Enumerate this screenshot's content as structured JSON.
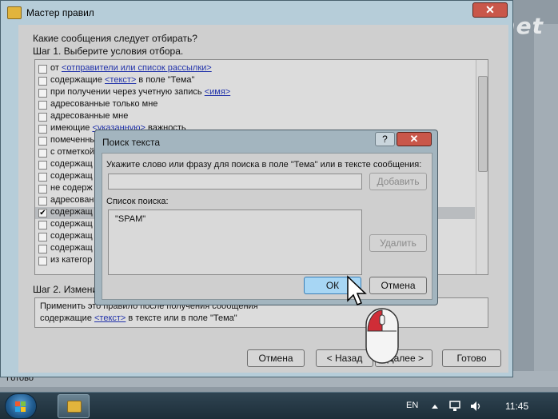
{
  "watermark": "lanet",
  "background_app": {
    "status_text": "Готово"
  },
  "rules_wizard": {
    "title": "Мастер правил",
    "close_glyph": "✕",
    "question": "Какие сообщения следует отбирать?",
    "step1": "Шаг 1. Выберите условия отбора.",
    "conditions": [
      {
        "pre": "от ",
        "link": "<отправители или список рассылки>",
        "post": "",
        "checked": false,
        "selected": false
      },
      {
        "pre": "содержащие ",
        "link": "<текст>",
        "post": " в поле \"Тема\"",
        "checked": false,
        "selected": false
      },
      {
        "pre": "при получении через учетную запись ",
        "link": "<имя>",
        "post": "",
        "checked": false,
        "selected": false
      },
      {
        "pre": "адресованные только мне",
        "link": "",
        "post": "",
        "checked": false,
        "selected": false
      },
      {
        "pre": "адресованные мне",
        "link": "",
        "post": "",
        "checked": false,
        "selected": false
      },
      {
        "pre": "имеющие ",
        "link": "<указанную>",
        "post": " важность",
        "checked": false,
        "selected": false
      },
      {
        "pre": "помеченные",
        "link": "",
        "post": "",
        "checked": false,
        "selected": false
      },
      {
        "pre": "с отметкой",
        "link": "",
        "post": "",
        "checked": false,
        "selected": false
      },
      {
        "pre": "содержащ",
        "link": "",
        "post": "",
        "checked": false,
        "selected": false
      },
      {
        "pre": "содержащ",
        "link": "",
        "post": "",
        "checked": false,
        "selected": false
      },
      {
        "pre": "не содерж",
        "link": "",
        "post": "",
        "checked": false,
        "selected": false
      },
      {
        "pre": "адресованн",
        "link": "",
        "post": "",
        "checked": false,
        "selected": false
      },
      {
        "pre": "содержащ",
        "link": "",
        "post": "",
        "checked": true,
        "selected": true
      },
      {
        "pre": "содержащ",
        "link": "",
        "post": "",
        "checked": false,
        "selected": false
      },
      {
        "pre": "содержащ",
        "link": "",
        "post": "",
        "checked": false,
        "selected": false
      },
      {
        "pre": "содержащ",
        "link": "",
        "post": "",
        "checked": false,
        "selected": false
      },
      {
        "pre": "из категор",
        "link": "",
        "post": "",
        "checked": false,
        "selected": false
      }
    ],
    "step2": "Шаг 2. Изменит",
    "description_line1": "Применить это правило после получения сообщения",
    "description_line2_pre": "содержащие ",
    "description_line2_link": "<текст>",
    "description_line2_post": " в тексте или в поле \"Тема\"",
    "buttons": {
      "cancel": "Отмена",
      "back": "< Назад",
      "next": "Далее >",
      "finish": "Готово"
    }
  },
  "search_dialog": {
    "title": "Поиск текста",
    "help_glyph": "?",
    "close_glyph": "✕",
    "prompt": "Укажите слово или фразу для поиска в поле \"Тема\" или в тексте сообщения:",
    "input_value": "",
    "add_button": "Добавить",
    "list_label": "Список поиска:",
    "list_items": [
      "\"SPAM\""
    ],
    "remove_button": "Удалить",
    "ok_button": "ОК",
    "cancel_button": "Отмена"
  },
  "taskbar": {
    "language": "EN",
    "clock": "11:45"
  },
  "colors": {
    "ok_button": "#a7d6f4",
    "link": "#2233aa",
    "close_button": "#c9574a"
  }
}
